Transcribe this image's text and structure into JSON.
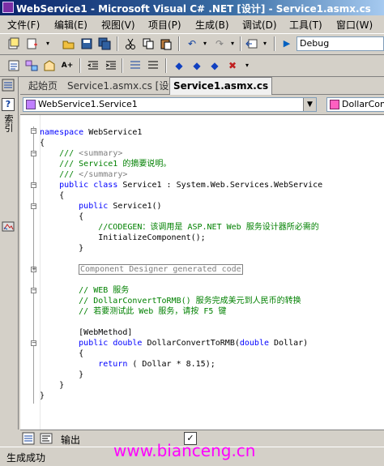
{
  "window": {
    "title": "WebService1 - Microsoft Visual C# .NET [设计] - Service1.asmx.cs"
  },
  "menu": [
    "文件(F)",
    "编辑(E)",
    "视图(V)",
    "项目(P)",
    "生成(B)",
    "调试(D)",
    "工具(T)",
    "窗口(W)"
  ],
  "toolbar": {
    "config_value": "Debug"
  },
  "tabs": [
    {
      "label": "起始页",
      "active": false
    },
    {
      "label": "Service1.asmx.cs [设计]",
      "active": false
    },
    {
      "label": "Service1.asmx.cs",
      "active": true
    }
  ],
  "left_dock": {
    "index_label": "索引"
  },
  "nav": {
    "class_combo": "WebService1.Service1",
    "member_combo": "DollarConv"
  },
  "code": {
    "l1_kw": "namespace",
    "l1_tx": " WebService1",
    "l2": "{",
    "l3_a": "    /// ",
    "l3_b": "<summary>",
    "l4": "    /// Service1 的摘要说明。",
    "l5_a": "    /// ",
    "l5_b": "</summary>",
    "l6_kw1": "    public",
    "l6_kw2": " class",
    "l6_tx": " Service1 : System.Web.Services.WebService",
    "l7": "    {",
    "l8_kw": "        public",
    "l8_tx": " Service1()",
    "l9": "        {",
    "l10": "            //CODEGEN：该调用是 ASP.NET Web 服务设计器所必需的",
    "l11": "            InitializeComponent();",
    "l12": "        }",
    "l13_box": "Component Designer generated code",
    "l14": "        // WEB 服务",
    "l15": "        // DollarConvertToRMB() 服务完成美元到人民币的转换",
    "l16": "        // 若要测试此 Web 服务，请按 F5 键",
    "l17": "        [WebMethod]",
    "l18_kw1": "        public",
    "l18_kw2": " double",
    "l18_tx1": " DollarConvertToRMB(",
    "l18_kw3": "double",
    "l18_tx2": " Dollar)",
    "l19": "        {",
    "l20_kw": "            return",
    "l20_tx": " ( Dollar * 8.15);",
    "l21": "        }",
    "l22": "    }",
    "l23": "}"
  },
  "output_panel": {
    "label": "输出"
  },
  "status": {
    "text": "生成成功"
  },
  "watermark": {
    "text": "www.bianceng.cn"
  }
}
